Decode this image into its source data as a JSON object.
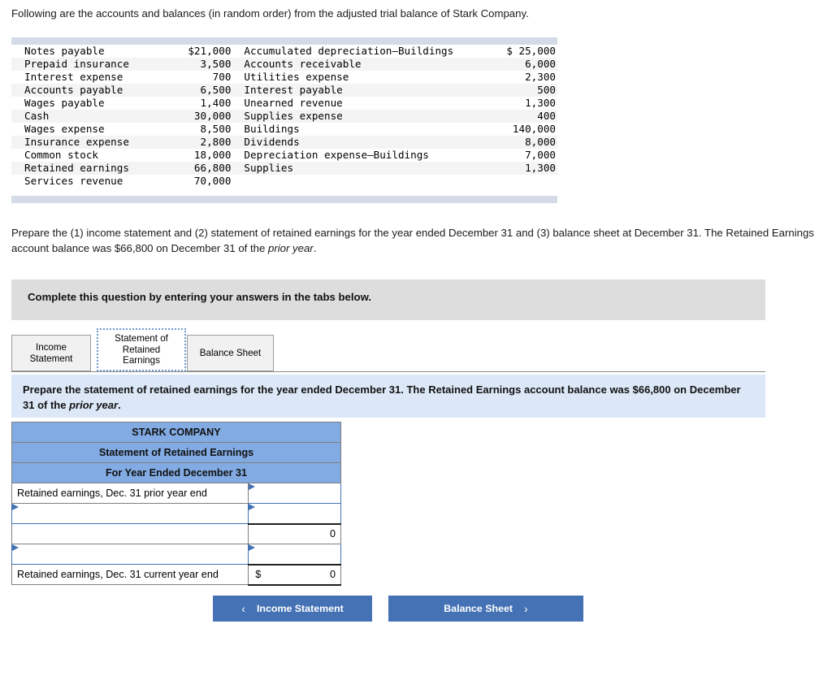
{
  "intro": "Following are the accounts and balances (in random order) from the adjusted trial balance of Stark Company.",
  "trial_balance": {
    "left": [
      {
        "account": "Notes payable",
        "amount": "$21,000"
      },
      {
        "account": "Prepaid insurance",
        "amount": "3,500"
      },
      {
        "account": "Interest expense",
        "amount": "700"
      },
      {
        "account": "Accounts payable",
        "amount": "6,500"
      },
      {
        "account": "Wages payable",
        "amount": "1,400"
      },
      {
        "account": "Cash",
        "amount": "30,000"
      },
      {
        "account": "Wages expense",
        "amount": "8,500"
      },
      {
        "account": "Insurance expense",
        "amount": "2,800"
      },
      {
        "account": "Common stock",
        "amount": "18,000"
      },
      {
        "account": "Retained earnings",
        "amount": "66,800"
      },
      {
        "account": "Services revenue",
        "amount": "70,000"
      }
    ],
    "right": [
      {
        "account": "Accumulated depreciation—Buildings",
        "amount": "$ 25,000"
      },
      {
        "account": "Accounts receivable",
        "amount": "6,000"
      },
      {
        "account": "Utilities expense",
        "amount": "2,300"
      },
      {
        "account": "Interest payable",
        "amount": "500"
      },
      {
        "account": "Unearned revenue",
        "amount": "1,300"
      },
      {
        "account": "Supplies expense",
        "amount": "400"
      },
      {
        "account": "Buildings",
        "amount": "140,000"
      },
      {
        "account": "Dividends",
        "amount": "8,000"
      },
      {
        "account": "Depreciation expense—Buildings",
        "amount": "7,000"
      },
      {
        "account": "Supplies",
        "amount": "1,300"
      },
      {
        "account": "",
        "amount": ""
      }
    ]
  },
  "prepare": {
    "part1": "Prepare the (1) income statement and (2) statement of retained earnings for the year ended December 31 and (3) balance sheet at December 31. The Retained Earnings account balance was $66,800 on December 31 of the ",
    "italic": "prior year",
    "part2": "."
  },
  "complete_bar": {
    "text": "Complete this question by entering your answers in the tabs below."
  },
  "tabs": [
    {
      "label": "Income Statement",
      "active": false
    },
    {
      "label": "Statement of Retained Earnings",
      "active": true
    },
    {
      "label": "Balance Sheet",
      "active": false
    }
  ],
  "tab_labels": {
    "income": "Income\nStatement",
    "sre": "Statement of\nRetained\nEarnings",
    "balance": "Balance Sheet"
  },
  "blue_panel": {
    "part1": "Prepare the statement of retained earnings for the year ended December 31. The Retained Earnings account balance was $66,800 on December 31 of the ",
    "italic": "prior year",
    "part2": "."
  },
  "answer_table": {
    "headers": [
      "STARK COMPANY",
      "Statement of Retained Earnings",
      "For Year Ended December 31"
    ],
    "rows": [
      {
        "label": "Retained earnings, Dec. 31 prior year end",
        "value": "",
        "label_dropdown": false,
        "value_dropdown": true,
        "value_rule": "none",
        "dollar": ""
      },
      {
        "label": "",
        "value": "",
        "label_dropdown": true,
        "value_dropdown": true,
        "value_rule": "none",
        "dollar": ""
      },
      {
        "label": "",
        "value": "0",
        "label_dropdown": false,
        "value_dropdown": false,
        "value_rule": "top",
        "dollar": ""
      },
      {
        "label": "",
        "value": "",
        "label_dropdown": true,
        "value_dropdown": true,
        "value_rule": "none",
        "dollar": ""
      },
      {
        "label": "Retained earnings, Dec. 31 current year end",
        "value": "0",
        "label_dropdown": false,
        "value_dropdown": false,
        "value_rule": "both",
        "dollar": "$"
      }
    ]
  },
  "nav_buttons": {
    "prev": {
      "label": "Income Statement",
      "chevron": "‹",
      "icon": "chevron-left-icon"
    },
    "next": {
      "label": "Balance Sheet",
      "chevron": "›",
      "icon": "chevron-right-icon"
    }
  },
  "colors": {
    "header_blue": "#82abe3",
    "button_blue": "#4472b4",
    "panel_blue": "#dce8f7",
    "gray_bar": "#dddddd",
    "table_band": "#d4dbe7"
  }
}
